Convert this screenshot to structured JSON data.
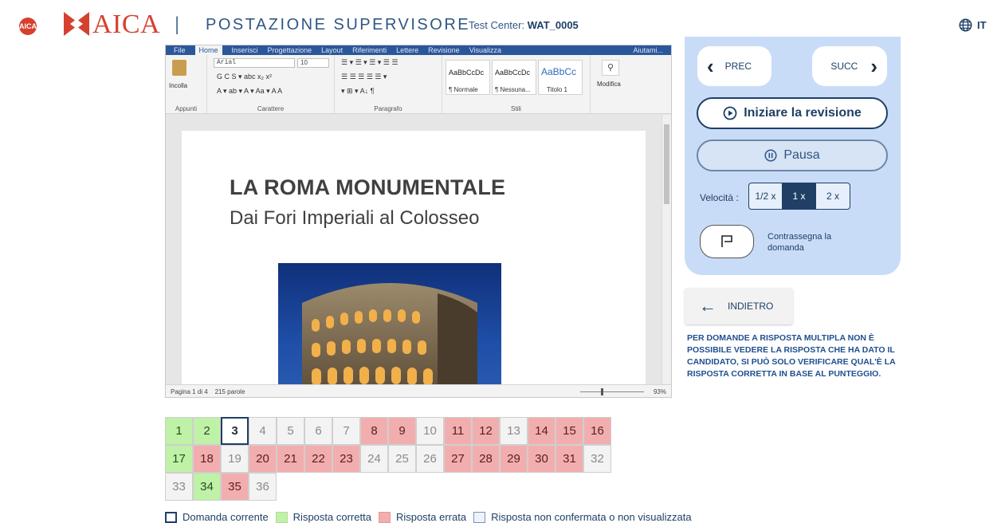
{
  "header": {
    "small_logo": "AICA",
    "brand": "AICA",
    "separator": "|",
    "title": "POSTAZIONE SUPERVISORE",
    "test_center_label": "Test Center:",
    "test_center_value": "WAT_0005",
    "language": "IT"
  },
  "word": {
    "menu": [
      "File",
      "Home",
      "Inserisci",
      "Progettazione",
      "Layout",
      "Riferimenti",
      "Lettere",
      "Revisione",
      "Visualizza"
    ],
    "help": "Aiutami...",
    "ribbon": {
      "paste_label": "Incolla",
      "font_name": "Arial",
      "font_size": "10",
      "format_row1": "G  C  S ▾ abc  x₂  x²",
      "format_row2": "A ▾  ab ▾  A ▾  Aa ▾   A  A",
      "paragraph_row1": "☰ ▾ ☰ ▾ ☰ ▾   ☰  ☰",
      "paragraph_row2": "☰  ☰  ☰  ☰   ☰ ▾",
      "paragraph_row3": "▾  ⊞ ▾   A↓   ¶",
      "groups": [
        "Appunti",
        "Carattere",
        "Paragrafo",
        "Stili"
      ],
      "styles": [
        {
          "sample": "AaBbCcDc",
          "name": "¶ Normale"
        },
        {
          "sample": "AaBbCcDc",
          "name": "¶ Nessuna..."
        },
        {
          "sample": "AaBbCc",
          "name": "Titolo 1"
        }
      ],
      "modifica": "Modifica"
    },
    "document": {
      "title": "LA ROMA MONUMENTALE",
      "subtitle": "Dai Fori Imperiali al Colosseo"
    },
    "status": {
      "page": "Pagina 1 di 4",
      "words": "215  parole",
      "zoom": "93%"
    }
  },
  "panel": {
    "prev": "PREC",
    "next": "SUCC",
    "start_review": "Iniziare la revisione",
    "pause": "Pausa",
    "speed_label": "Velocità :",
    "speeds": [
      "1/2 x",
      "1 x",
      "2 x"
    ],
    "selected_speed": "1 x",
    "flag_label": "Contrassegna la domanda"
  },
  "back_label": "INDIETRO",
  "notice": "PER DOMANDE A RISPOSTA MULTIPLA NON È POSSIBILE VEDERE LA RISPOSTA CHE HA DATO IL CANDIDATO, SI PUÒ SOLO VERIFICARE QUAL'È LA RISPOSTA CORRETTA IN BASE AL PUNTEGGIO.",
  "questions": [
    {
      "n": "1",
      "status": "correct"
    },
    {
      "n": "2",
      "status": "correct"
    },
    {
      "n": "3",
      "status": "current"
    },
    {
      "n": "4",
      "status": "unseen"
    },
    {
      "n": "5",
      "status": "unseen"
    },
    {
      "n": "6",
      "status": "unseen"
    },
    {
      "n": "7",
      "status": "unseen"
    },
    {
      "n": "8",
      "status": "wrong"
    },
    {
      "n": "9",
      "status": "wrong"
    },
    {
      "n": "10",
      "status": "unseen"
    },
    {
      "n": "11",
      "status": "wrong"
    },
    {
      "n": "12",
      "status": "wrong"
    },
    {
      "n": "13",
      "status": "unseen"
    },
    {
      "n": "14",
      "status": "wrong"
    },
    {
      "n": "15",
      "status": "wrong"
    },
    {
      "n": "16",
      "status": "wrong"
    },
    {
      "n": "17",
      "status": "correct"
    },
    {
      "n": "18",
      "status": "wrong"
    },
    {
      "n": "19",
      "status": "unseen"
    },
    {
      "n": "20",
      "status": "wrong"
    },
    {
      "n": "21",
      "status": "wrong"
    },
    {
      "n": "22",
      "status": "wrong"
    },
    {
      "n": "23",
      "status": "wrong"
    },
    {
      "n": "24",
      "status": "unseen"
    },
    {
      "n": "25",
      "status": "unseen"
    },
    {
      "n": "26",
      "status": "unseen"
    },
    {
      "n": "27",
      "status": "wrong"
    },
    {
      "n": "28",
      "status": "wrong"
    },
    {
      "n": "29",
      "status": "wrong"
    },
    {
      "n": "30",
      "status": "wrong"
    },
    {
      "n": "31",
      "status": "wrong"
    },
    {
      "n": "32",
      "status": "unseen"
    },
    {
      "n": "33",
      "status": "unseen"
    },
    {
      "n": "34",
      "status": "correct"
    },
    {
      "n": "35",
      "status": "wrong"
    },
    {
      "n": "36",
      "status": "unseen"
    }
  ],
  "legend": [
    {
      "label": "Domanda corrente",
      "kind": "current"
    },
    {
      "label": "Risposta corretta",
      "kind": "correct"
    },
    {
      "label": "Risposta errata",
      "kind": "wrong"
    },
    {
      "label": "Risposta non confermata o non visualizzata",
      "kind": "unseen"
    }
  ],
  "colors": {
    "brand_red": "#d5412f",
    "navy": "#1f3f66",
    "panel_bg": "#c9dcf7",
    "correct": "#bff1a7",
    "wrong": "#f2aeae",
    "unseen": "#f3f3f3"
  }
}
